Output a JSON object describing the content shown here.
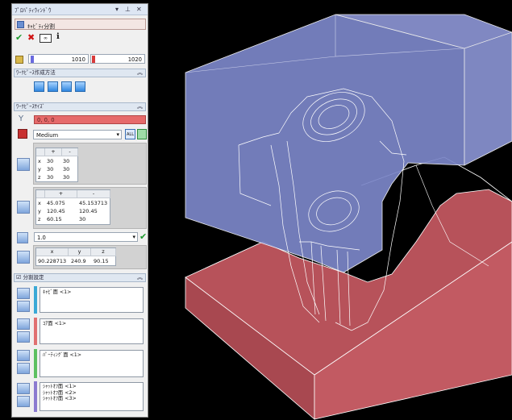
{
  "panel": {
    "title": "ﾌﾟﾛﾊﾟﾃｨｳｨﾝﾄﾞｳ",
    "mode_label": "ｷｬﾋﾞﾃｨ分割",
    "slider_left_value": "1010",
    "slider_right_value": "1020"
  },
  "sections": {
    "workpiece_method": "ﾜｰｸﾋﾟｰｽ作成方法",
    "workpiece_size": "ﾜｰｸﾋﾟｰｽｻｲｽﾞ",
    "split_settings": "分割設定"
  },
  "origin": {
    "value": "0, 0, 0"
  },
  "preset": {
    "value": "Medium"
  },
  "offset_table": {
    "headers": [
      "+",
      "-"
    ],
    "rows": [
      {
        "axis": "x",
        "plus": "30",
        "minus": "30"
      },
      {
        "axis": "y",
        "plus": "30",
        "minus": "30"
      },
      {
        "axis": "z",
        "plus": "30",
        "minus": "30"
      }
    ]
  },
  "size_table": {
    "headers": [
      "+",
      "-"
    ],
    "rows": [
      {
        "axis": "x",
        "plus": "45.075",
        "minus": "45.153713"
      },
      {
        "axis": "y",
        "plus": "120.45",
        "minus": "120.45"
      },
      {
        "axis": "z",
        "plus": "60.15",
        "minus": "30"
      }
    ]
  },
  "scale": {
    "value": "1.0"
  },
  "dimensions": {
    "headers": [
      "x",
      "y",
      "z"
    ],
    "values": [
      "90.228713",
      "240.9",
      "90.15"
    ]
  },
  "split_lists": {
    "cavity": [
      "ｷｬﾋﾞ面 <1>"
    ],
    "core": [
      "ｺｱ面 <1>"
    ],
    "parting": [
      "ﾊﾟｰﾃｨﾝｸﾞ面 <1>"
    ],
    "shutoff": [
      "ｼｬｯﾄｵﾌ面 <1>",
      "ｼｬｯﾄｵﾌ面 <2>",
      "ｼｬｯﾄｵﾌ面 <3>"
    ]
  },
  "colors": {
    "cavity_blue": "#8e97d6",
    "core_red": "#c0555d",
    "accent_bar_red": "#e06666",
    "stripe_cavity": "#3aa9d6",
    "stripe_core": "#e07070",
    "stripe_parting": "#5cc060",
    "stripe_shutoff": "#8b7ad0"
  }
}
